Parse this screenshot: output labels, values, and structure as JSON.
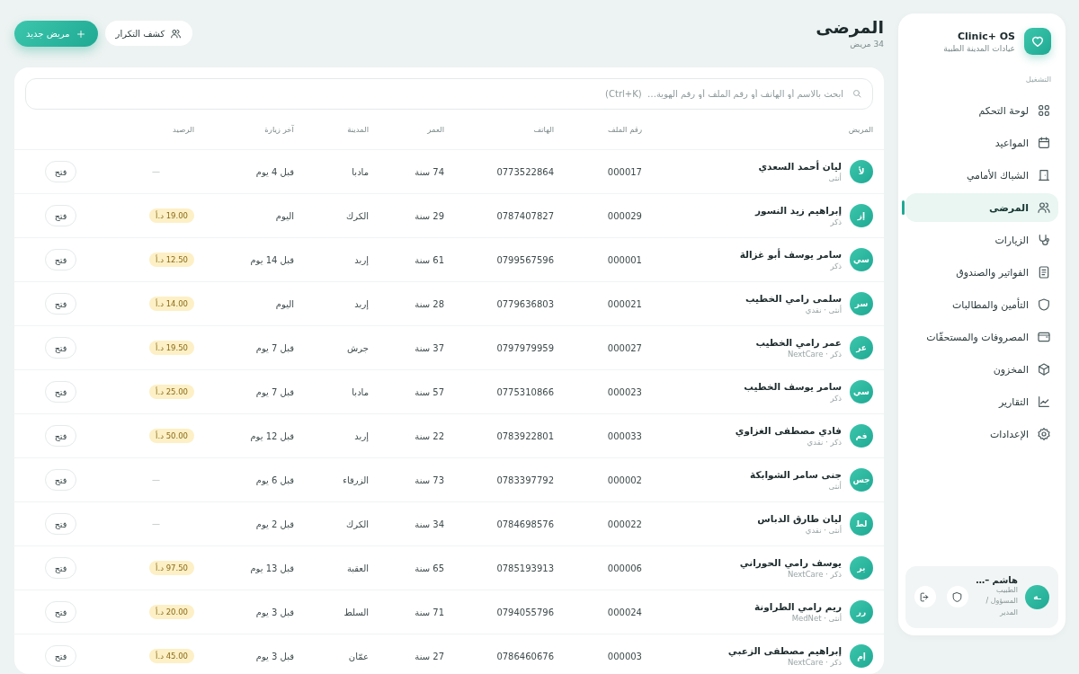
{
  "brand": {
    "name": "Clinic+ OS",
    "subtitle": "عيادات المدينة الطبية"
  },
  "sidebar": {
    "section": "التشغيل",
    "items": [
      {
        "label": "لوحة التحكم",
        "selected": false
      },
      {
        "label": "المواعيد",
        "selected": false
      },
      {
        "label": "الشباك الأمامي",
        "selected": false
      },
      {
        "label": "المرضى",
        "selected": true
      },
      {
        "label": "الزيارات",
        "selected": false
      },
      {
        "label": "الفواتير والصندوق",
        "selected": false
      },
      {
        "label": "التأمين والمطالبات",
        "selected": false
      },
      {
        "label": "المصروفات والمستحقّات",
        "selected": false
      },
      {
        "label": "المخزون",
        "selected": false
      },
      {
        "label": "التقارير",
        "selected": false
      },
      {
        "label": "الإعدادات",
        "selected": false
      }
    ]
  },
  "user": {
    "initials": "ـه",
    "name": "هاشم –…",
    "role": "الطبيب المسؤول / المدير"
  },
  "header": {
    "title": "المرضى",
    "count": "34 مريض",
    "duplicates_button": "كشف التكرار",
    "new_button": "مريض جديد"
  },
  "search": {
    "placeholder": "ابحث بالاسم أو الهاتف أو رقم الملف أو رقم الهوية…  (Ctrl+K)"
  },
  "table": {
    "columns": [
      "المريض",
      "رقم الملف",
      "الهاتف",
      "العمر",
      "المدينة",
      "آخر زيارة",
      "الرصيد"
    ],
    "rows": [
      {
        "initials": "لأ",
        "name": "ليان أحمد السعدي",
        "meta": "أنثى",
        "file": "000017",
        "phone": "0773522864",
        "age": "74 سنة",
        "city": "مادبا",
        "last_visit": "قبل 4 يوم",
        "balance": "—",
        "owed": false,
        "action": "فتح"
      },
      {
        "initials": "إز",
        "name": "إبراهيم زيد النسور",
        "meta": "ذكر",
        "file": "000029",
        "phone": "0787407827",
        "age": "29 سنة",
        "city": "الكرك",
        "last_visit": "اليوم",
        "balance": "19.00 د.أ",
        "owed": true,
        "action": "فتح"
      },
      {
        "initials": "سي",
        "name": "سامر يوسف أبو غزالة",
        "meta": "ذكر",
        "file": "000001",
        "phone": "0799567596",
        "age": "61 سنة",
        "city": "إربد",
        "last_visit": "قبل 14 يوم",
        "balance": "12.50 د.أ",
        "owed": true,
        "action": "فتح"
      },
      {
        "initials": "سر",
        "name": "سلمى رامي الخطيب",
        "meta": "أنثى · نقدي",
        "file": "000021",
        "phone": "0779636803",
        "age": "28 سنة",
        "city": "إربد",
        "last_visit": "اليوم",
        "balance": "14.00 د.أ",
        "owed": true,
        "action": "فتح"
      },
      {
        "initials": "عر",
        "name": "عمر رامي الخطيب",
        "meta": "ذكر · NextCare",
        "file": "000027",
        "phone": "0797979959",
        "age": "37 سنة",
        "city": "جرش",
        "last_visit": "قبل 7 يوم",
        "balance": "19.50 د.أ",
        "owed": true,
        "action": "فتح"
      },
      {
        "initials": "سي",
        "name": "سامر يوسف الخطيب",
        "meta": "ذكر",
        "file": "000023",
        "phone": "0775310866",
        "age": "57 سنة",
        "city": "مادبا",
        "last_visit": "قبل 7 يوم",
        "balance": "25.00 د.أ",
        "owed": true,
        "action": "فتح"
      },
      {
        "initials": "فم",
        "name": "فادي مصطفى الغزاوي",
        "meta": "ذكر · نقدي",
        "file": "000033",
        "phone": "0783922801",
        "age": "22 سنة",
        "city": "إربد",
        "last_visit": "قبل 12 يوم",
        "balance": "50.00 د.أ",
        "owed": true,
        "action": "فتح"
      },
      {
        "initials": "جس",
        "name": "جنى سامر الشوابكة",
        "meta": "أنثى",
        "file": "000002",
        "phone": "0783397792",
        "age": "73 سنة",
        "city": "الزرقاء",
        "last_visit": "قبل 6 يوم",
        "balance": "—",
        "owed": false,
        "action": "فتح"
      },
      {
        "initials": "لط",
        "name": "ليان طارق الدباس",
        "meta": "أنثى · نقدي",
        "file": "000022",
        "phone": "0784698576",
        "age": "34 سنة",
        "city": "الكرك",
        "last_visit": "قبل 2 يوم",
        "balance": "—",
        "owed": false,
        "action": "فتح"
      },
      {
        "initials": "ير",
        "name": "يوسف رامي الحوراني",
        "meta": "ذكر · NextCare",
        "file": "000006",
        "phone": "0785193913",
        "age": "65 سنة",
        "city": "العقبة",
        "last_visit": "قبل 13 يوم",
        "balance": "97.50 د.أ",
        "owed": true,
        "action": "فتح"
      },
      {
        "initials": "رر",
        "name": "ريم رامي الطراونة",
        "meta": "أنثى · MedNet",
        "file": "000024",
        "phone": "0794055796",
        "age": "71 سنة",
        "city": "السلط",
        "last_visit": "قبل 3 يوم",
        "balance": "20.00 د.أ",
        "owed": true,
        "action": "فتح"
      },
      {
        "initials": "إم",
        "name": "إبراهيم مصطفى الزعبي",
        "meta": "ذكر · NextCare",
        "file": "000003",
        "phone": "0786460676",
        "age": "27 سنة",
        "city": "عمّان",
        "last_visit": "قبل 3 يوم",
        "balance": "45.00 د.أ",
        "owed": true,
        "action": "فتح"
      }
    ]
  }
}
